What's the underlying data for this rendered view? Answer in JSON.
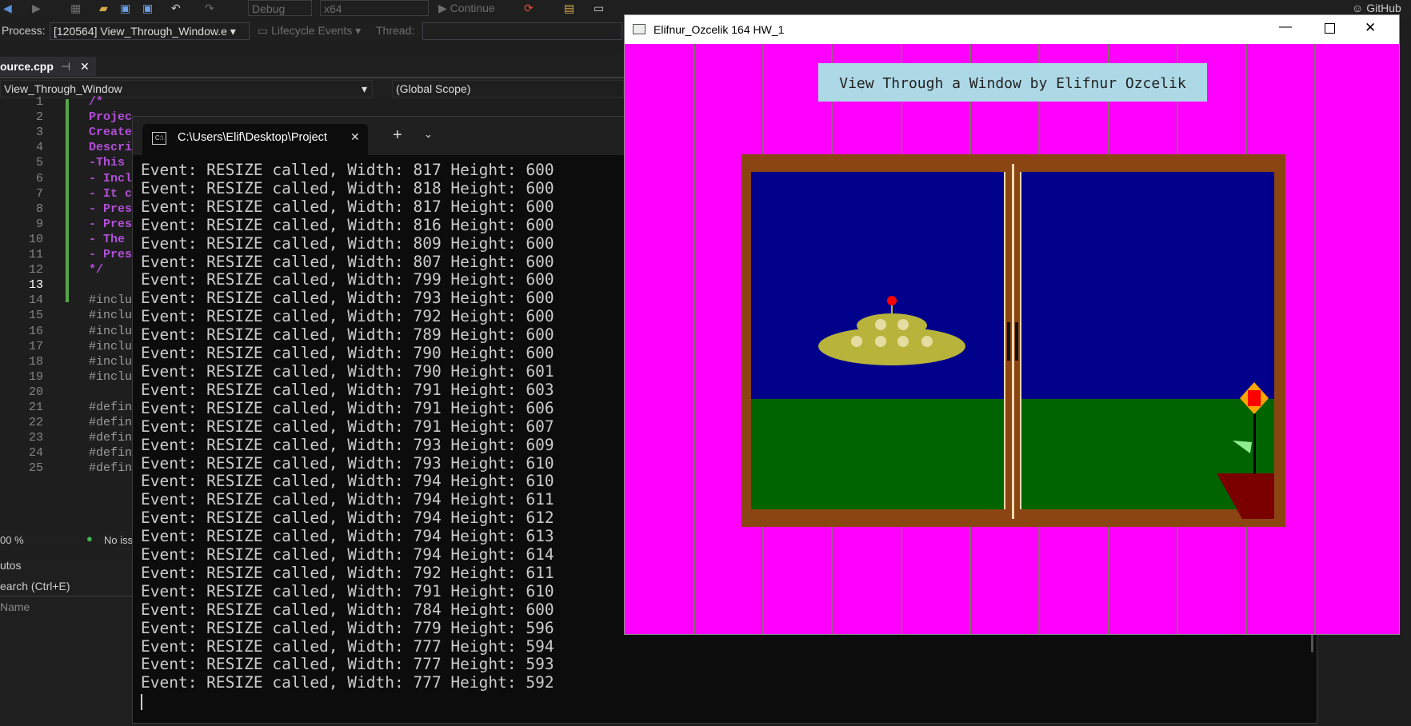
{
  "toolbar": {
    "config": "Debug",
    "platform": "x64",
    "continue_label": "Continue",
    "github_label": "GitHub"
  },
  "process_bar": {
    "process_label": "Process:",
    "process_value": "[120564] View_Through_Window.e",
    "lifecycle_label": "Lifecycle Events",
    "thread_label": "Thread:"
  },
  "editor": {
    "tab_title": "ource.cpp",
    "nav_project": "View_Through_Window",
    "nav_scope": "(Global Scope)",
    "line_numbers": [
      "1",
      "2",
      "3",
      "4",
      "5",
      "6",
      "7",
      "8",
      "9",
      "10",
      "11",
      "12",
      "13",
      "14",
      "15",
      "16",
      "17",
      "18",
      "19",
      "20",
      "21",
      "22",
      "23",
      "24",
      "25"
    ],
    "lines": [
      "/*",
      "Projec",
      "Create",
      "Descri",
      "-This ",
      "- Incl",
      "- It c",
      "- Pres",
      "- Pres",
      "- The ",
      "- Pres",
      "*/",
      "",
      "#inclu",
      "#inclu",
      "#inclu",
      "#inclu",
      "#inclu",
      "#inclu",
      "",
      "#defin",
      "#defin",
      "#defin",
      "#defin",
      "#defin"
    ],
    "zoom": "00 %",
    "status": "No iss"
  },
  "autos": {
    "title": "utos",
    "search_placeholder": "earch (Ctrl+E)",
    "column_name": "Name"
  },
  "terminal": {
    "tab_title": "C:\\Users\\Elif\\Desktop\\Project",
    "lines": [
      "Event: RESIZE called, Width: 817 Height: 600",
      "Event: RESIZE called, Width: 818 Height: 600",
      "Event: RESIZE called, Width: 817 Height: 600",
      "Event: RESIZE called, Width: 816 Height: 600",
      "Event: RESIZE called, Width: 809 Height: 600",
      "Event: RESIZE called, Width: 807 Height: 600",
      "Event: RESIZE called, Width: 799 Height: 600",
      "Event: RESIZE called, Width: 793 Height: 600",
      "Event: RESIZE called, Width: 792 Height: 600",
      "Event: RESIZE called, Width: 789 Height: 600",
      "Event: RESIZE called, Width: 790 Height: 600",
      "Event: RESIZE called, Width: 790 Height: 601",
      "Event: RESIZE called, Width: 791 Height: 603",
      "Event: RESIZE called, Width: 791 Height: 606",
      "Event: RESIZE called, Width: 791 Height: 607",
      "Event: RESIZE called, Width: 793 Height: 609",
      "Event: RESIZE called, Width: 793 Height: 610",
      "Event: RESIZE called, Width: 794 Height: 610",
      "Event: RESIZE called, Width: 794 Height: 611",
      "Event: RESIZE called, Width: 794 Height: 612",
      "Event: RESIZE called, Width: 794 Height: 613",
      "Event: RESIZE called, Width: 794 Height: 614",
      "Event: RESIZE called, Width: 792 Height: 611",
      "Event: RESIZE called, Width: 791 Height: 610",
      "Event: RESIZE called, Width: 784 Height: 600",
      "Event: RESIZE called, Width: 779 Height: 596",
      "Event: RESIZE called, Width: 777 Height: 594",
      "Event: RESIZE called, Width: 777 Height: 593",
      "Event: RESIZE called, Width: 777 Height: 592"
    ]
  },
  "gl_window": {
    "title": "Elifnur_Ozcelik 164 HW_1",
    "banner_text": "View Through a Window by Elifnur Ozcelik"
  },
  "colors": {
    "wall": "#ff00ff",
    "sky": "#00008b",
    "grass": "#006400",
    "frame": "#8b4513",
    "banner": "#add8e6",
    "ufo": "#b8b33a",
    "pot": "#7a0000"
  }
}
